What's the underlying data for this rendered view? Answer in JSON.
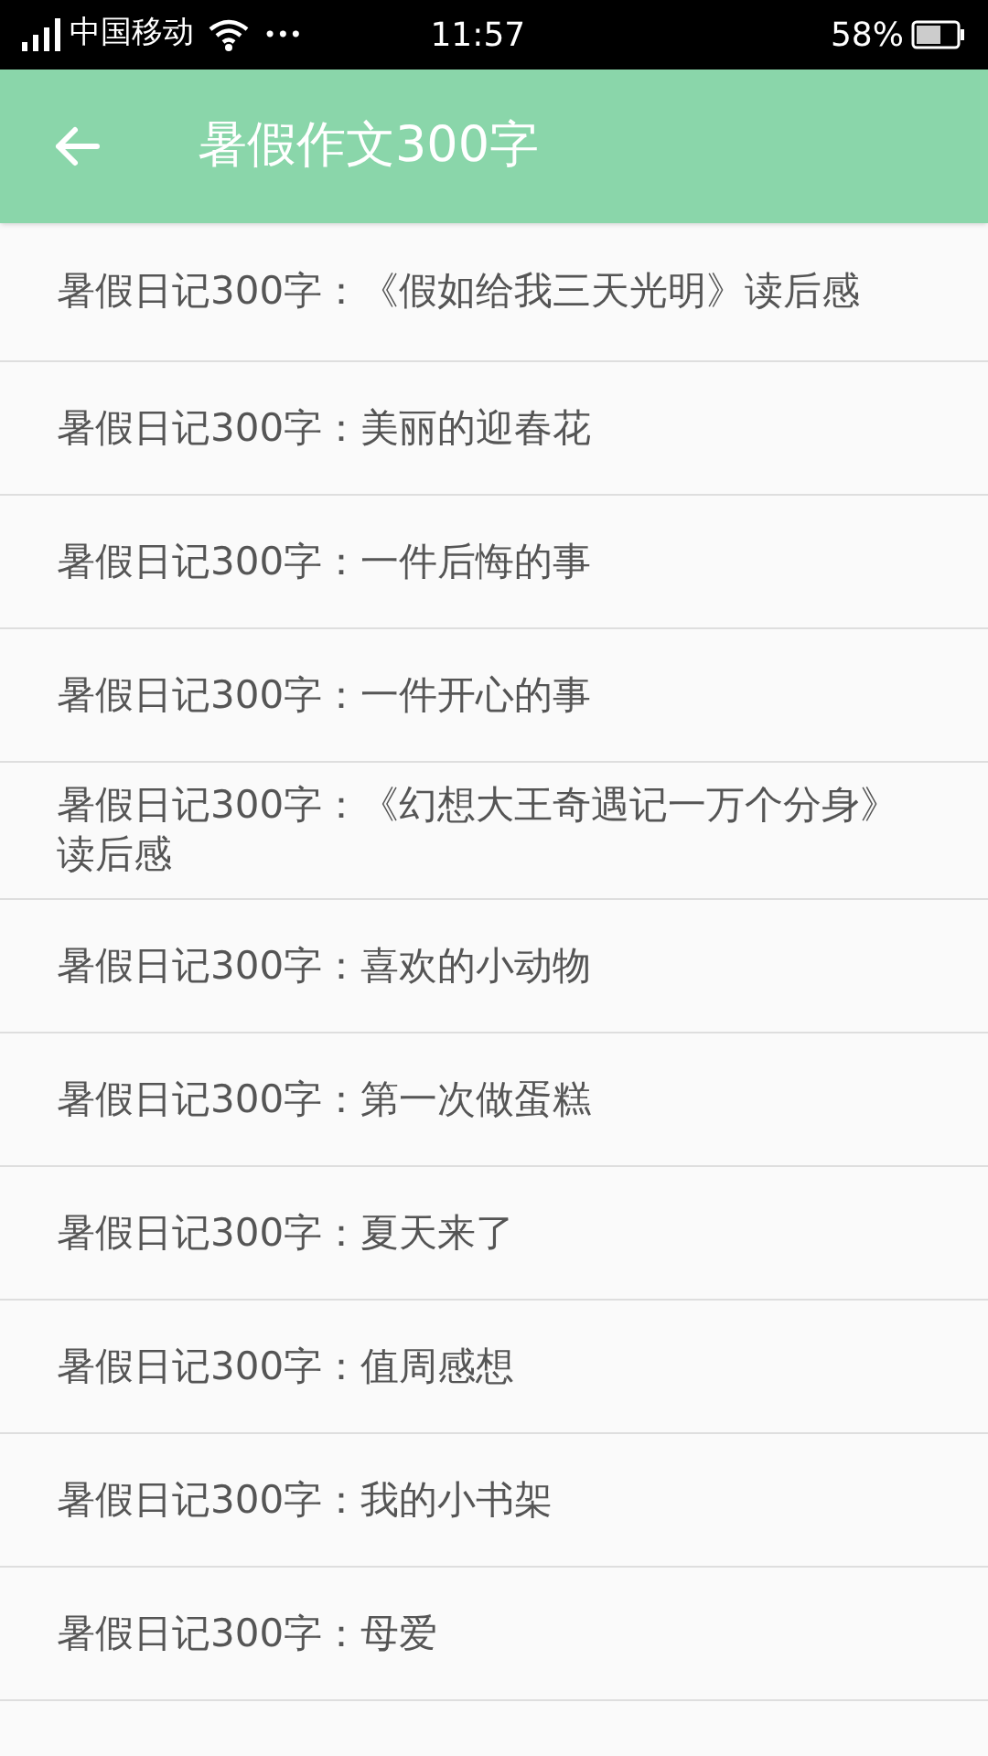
{
  "status_bar": {
    "carrier": "中国移动",
    "dots": "•••",
    "time": "11:57",
    "battery": "58%"
  },
  "app_bar": {
    "title": "暑假作文300字"
  },
  "items": [
    {
      "title": "暑假日记300字：《假如给我三天光明》读后感"
    },
    {
      "title": "暑假日记300字：美丽的迎春花"
    },
    {
      "title": "暑假日记300字：一件后悔的事"
    },
    {
      "title": "暑假日记300字：一件开心的事"
    },
    {
      "title": "暑假日记300字：《幻想大王奇遇记一万个分身》读后感"
    },
    {
      "title": "暑假日记300字：喜欢的小动物"
    },
    {
      "title": "暑假日记300字：第一次做蛋糕"
    },
    {
      "title": "暑假日记300字：夏天来了"
    },
    {
      "title": "暑假日记300字：值周感想"
    },
    {
      "title": "暑假日记300字：我的小书架"
    },
    {
      "title": "暑假日记300字：母爱"
    }
  ]
}
